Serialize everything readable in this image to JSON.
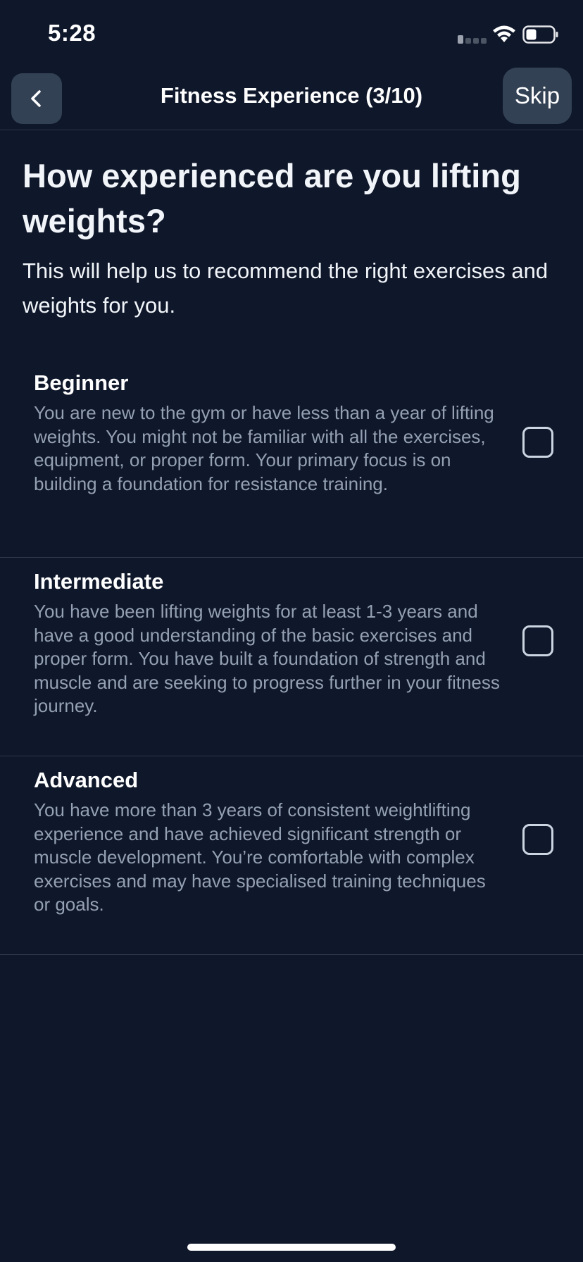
{
  "status_bar": {
    "time": "5:28"
  },
  "nav": {
    "title": "Fitness Experience (3/10)",
    "skip_label": "Skip",
    "back_icon": "chevron-left-icon"
  },
  "question": {
    "title": "How experienced are you lifting weights?",
    "subtitle": "This will help us to recommend the right exercises and weights for you."
  },
  "options": [
    {
      "title": "Beginner",
      "description": "You are new to the gym or have less than a year of lifting weights. You might not be familiar with all the exercises, equipment, or proper form. Your primary focus is on building a foundation for resistance training.",
      "checked": false
    },
    {
      "title": "Intermediate",
      "description": "You have been lifting weights for at least 1-3 years and have a good understanding of the basic exercises and proper form. You have built a foundation of strength and muscle and are seeking to progress further in your fitness journey.",
      "checked": false
    },
    {
      "title": "Advanced",
      "description": "You have more than 3 years of consistent weightlifting experience and have achieved significant strength or muscle development. You’re comfortable with complex exercises and may have specialised training techniques or goals.",
      "checked": false
    }
  ],
  "colors": {
    "background": "#0f172a",
    "button_bg": "#334155",
    "muted_text": "#94a0b3"
  }
}
